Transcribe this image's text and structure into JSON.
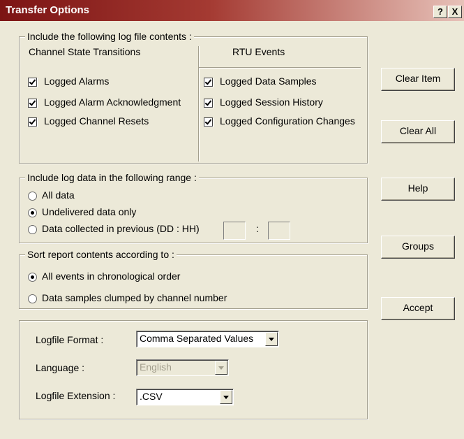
{
  "window": {
    "title": "Transfer Options",
    "help_btn": "?",
    "close_btn": "X"
  },
  "contents": {
    "legend": "Include the following log file contents :",
    "col1_header": "Channel State Transitions",
    "col2_header": "RTU Events",
    "channel_items": [
      {
        "label": "Logged Alarms",
        "checked": true
      },
      {
        "label": "Logged Alarm Acknowledgment",
        "checked": true
      },
      {
        "label": "Logged Channel Resets",
        "checked": true
      }
    ],
    "rtu_items": [
      {
        "label": "Logged Data Samples",
        "checked": true
      },
      {
        "label": "Logged Session History",
        "checked": true
      },
      {
        "label": "Logged Configuration Changes",
        "checked": true
      }
    ]
  },
  "range": {
    "legend": "Include log data in the following range :",
    "options": [
      {
        "label": "All data",
        "selected": false
      },
      {
        "label": "Undelivered data only",
        "selected": true
      },
      {
        "label": "Data collected in previous (DD : HH)",
        "selected": false
      }
    ],
    "separator": ":",
    "days_value": "",
    "hours_value": ""
  },
  "sort": {
    "legend": "Sort report contents according to :",
    "options": [
      {
        "label": "All events in chronological order",
        "selected": true
      },
      {
        "label": "Data samples clumped by channel number",
        "selected": false
      }
    ]
  },
  "format": {
    "logfile_format_label": "Logfile Format :",
    "logfile_format_value": "Comma Separated Values",
    "language_label": "Language :",
    "language_value": "English",
    "extension_label": "Logfile Extension :",
    "extension_value": ".CSV"
  },
  "buttons": {
    "clear_item": "Clear Item",
    "clear_all": "Clear All",
    "help": "Help",
    "groups": "Groups",
    "accept": "Accept"
  }
}
